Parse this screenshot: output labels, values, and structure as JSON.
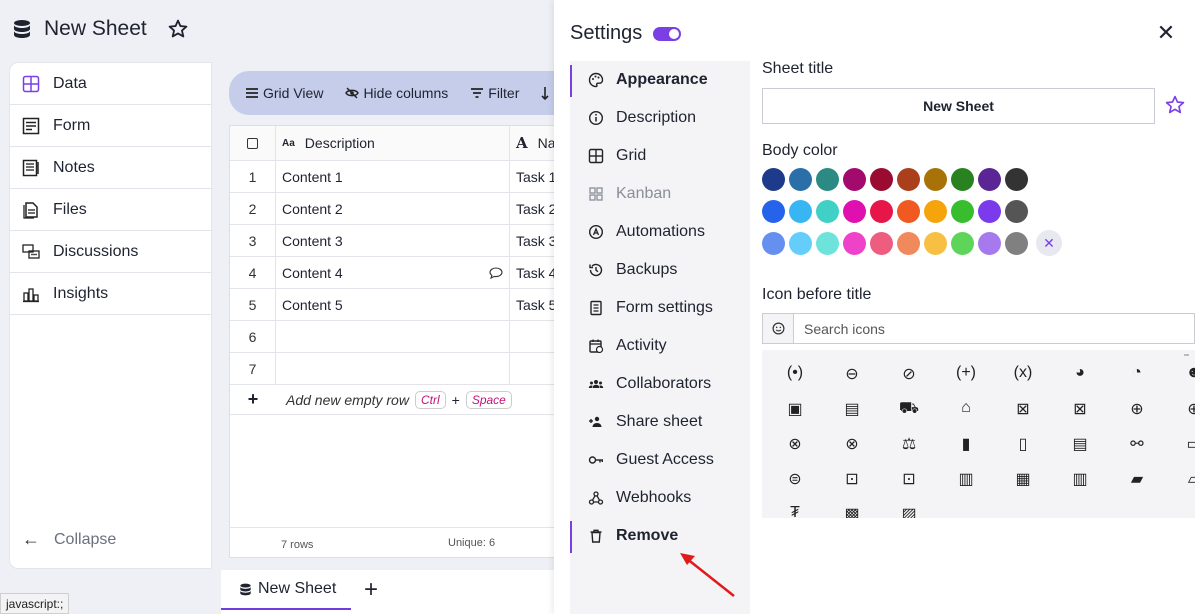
{
  "header": {
    "title": "New Sheet"
  },
  "sidebar": {
    "items": [
      {
        "label": "Data",
        "icon": "grid-icon"
      },
      {
        "label": "Form",
        "icon": "form-icon"
      },
      {
        "label": "Notes",
        "icon": "notes-icon"
      },
      {
        "label": "Files",
        "icon": "files-icon"
      },
      {
        "label": "Discussions",
        "icon": "discussions-icon"
      },
      {
        "label": "Insights",
        "icon": "insights-icon"
      }
    ],
    "collapse_label": "Collapse"
  },
  "toolbar": {
    "grid_view": "Grid View",
    "hide_columns": "Hide columns",
    "filter": "Filter"
  },
  "grid": {
    "columns": [
      "Description",
      "Na"
    ],
    "rows": [
      {
        "num": "1",
        "description": "Content 1",
        "name": "Task 1"
      },
      {
        "num": "2",
        "description": "Content 2",
        "name": "Task 2"
      },
      {
        "num": "3",
        "description": "Content 3",
        "name": "Task 3"
      },
      {
        "num": "4",
        "description": "Content 4",
        "name": "Task 4"
      },
      {
        "num": "5",
        "description": "Content 5",
        "name": "Task 5"
      },
      {
        "num": "6",
        "description": "",
        "name": ""
      },
      {
        "num": "7",
        "description": "",
        "name": ""
      }
    ],
    "add_row_label": "Add new empty row",
    "kbd_ctrl": "Ctrl",
    "kbd_plus": "+",
    "kbd_space": "Space",
    "footer_rows": "7 rows",
    "footer_unique": "Unique: 6"
  },
  "bottom_tabs": {
    "active_tab": "New Sheet",
    "add_label": "+"
  },
  "status_bar": {
    "text": "javascript:;"
  },
  "settings": {
    "title": "Settings",
    "close_label": "✕",
    "menu": [
      {
        "label": "Appearance",
        "icon": "palette-icon",
        "state": "active"
      },
      {
        "label": "Description",
        "icon": "info-icon",
        "state": "normal"
      },
      {
        "label": "Grid",
        "icon": "grid-icon",
        "state": "normal"
      },
      {
        "label": "Kanban",
        "icon": "kanban-icon",
        "state": "disabled"
      },
      {
        "label": "Automations",
        "icon": "automations-icon",
        "state": "normal"
      },
      {
        "label": "Backups",
        "icon": "history-icon",
        "state": "normal"
      },
      {
        "label": "Form settings",
        "icon": "form-settings-icon",
        "state": "normal"
      },
      {
        "label": "Activity",
        "icon": "activity-icon",
        "state": "normal"
      },
      {
        "label": "Collaborators",
        "icon": "collaborators-icon",
        "state": "normal"
      },
      {
        "label": "Share sheet",
        "icon": "share-sheet-icon",
        "state": "normal"
      },
      {
        "label": "Guest Access",
        "icon": "key-icon",
        "state": "normal"
      },
      {
        "label": "Webhooks",
        "icon": "webhooks-icon",
        "state": "normal"
      },
      {
        "label": "Remove",
        "icon": "trash-icon",
        "state": "highlight"
      }
    ],
    "sheet_title_label": "Sheet title",
    "sheet_title_value": "New Sheet",
    "body_color_label": "Body color",
    "colors": [
      [
        "#1e3a8a",
        "#2a6fa8",
        "#2b8a84",
        "#a20a6e",
        "#9b0a30",
        "#a9401b",
        "#a87208",
        "#28821f",
        "#5b2596",
        "#333333"
      ],
      [
        "#2563eb",
        "#38b6f4",
        "#40d0c6",
        "#e010b0",
        "#e81548",
        "#f05a22",
        "#f5a50b",
        "#37bd2d",
        "#7c3aed",
        "#555555"
      ],
      [
        "#6690f0",
        "#64cdfa",
        "#6ee3dc",
        "#ee42c8",
        "#ee5c80",
        "#f08a5c",
        "#f8c042",
        "#5fd45a",
        "#a779ee",
        "#808080"
      ]
    ],
    "icon_before_title_label": "Icon before title",
    "search_placeholder": "Search icons",
    "icon_glyphs": [
      "(•)",
      "⊖",
      "⊘",
      "(+)",
      "(x)",
      "◕",
      "◔",
      "☻",
      "▣",
      "▤",
      "⛟",
      "⌂",
      "⊠",
      "⊠",
      "⊕",
      "⊕",
      "⊗",
      "⊗",
      "⚖",
      "▮",
      "▯",
      "▤",
      "⚯",
      "▭",
      "⊜",
      "⊡",
      "⊡",
      "▥",
      "▦",
      "▥",
      "▰",
      "▱",
      "₮",
      "▩",
      "▨"
    ]
  }
}
